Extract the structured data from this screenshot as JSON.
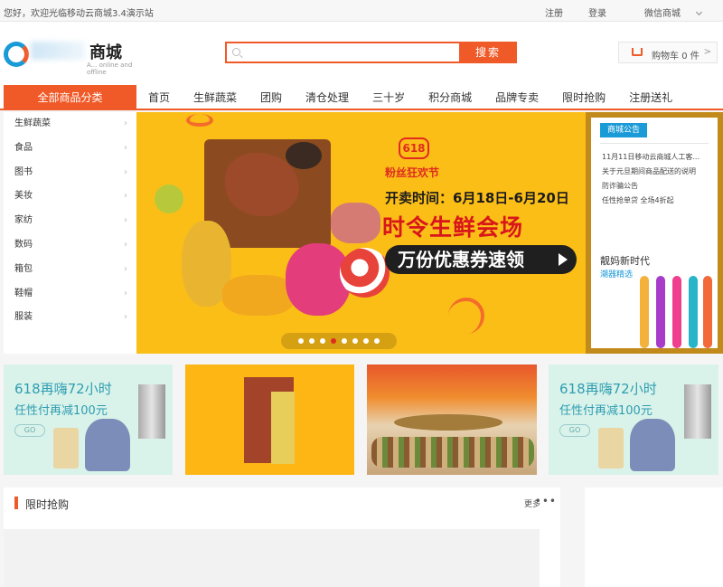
{
  "topbar": {
    "welcome": "您好，欢迎光临移动云商城3.4演示站",
    "register": "注册",
    "login": "登录",
    "wechat": "微信商城"
  },
  "header": {
    "logo_name": "商城",
    "logo_tagline": "A... online and offline",
    "search": {
      "value": "",
      "button": "搜索"
    },
    "cart": {
      "label": "购物车",
      "count": "0",
      "unit": "件",
      "arrow": ">"
    }
  },
  "nav": {
    "all_categories": "全部商品分类",
    "items": [
      "首页",
      "生鲜蔬菜",
      "团购",
      "清仓处理",
      "三十岁",
      "积分商城",
      "品牌专卖",
      "限时抢购",
      "注册送礼"
    ]
  },
  "categories": [
    "生鲜蔬菜",
    "食品",
    "图书",
    "美妆",
    "家纺",
    "数码",
    "箱包",
    "鞋帽",
    "服装"
  ],
  "banner": {
    "badge": "618",
    "fans": "粉丝狂欢节",
    "date": "开卖时间：6月18日-6月20日",
    "headline": "时令生鲜会场",
    "coupon": "万份优惠券速领",
    "dots": 8,
    "active_dot": 3
  },
  "notice": {
    "title": "商城公告",
    "items": [
      "11月11日移动云商城人工客...",
      "关于元旦期间商品配送的说明",
      "防诈骗公告",
      "任性抢单贷 全场4折起"
    ],
    "ad_title": "靓妈新时代",
    "ad_sub": "潮器精选",
    "wand_colors": [
      "#f4b13c",
      "#a63cc8",
      "#ef3f8e",
      "#27b5c8",
      "#f26a3a"
    ]
  },
  "promos": [
    {
      "title": "618再嗨72小时",
      "sub": "任性付再减100元",
      "go": "GO"
    },
    {
      "title": "618再嗨72小时",
      "sub": "任性付再减100元",
      "go": "GO"
    }
  ],
  "flash": {
    "title": "限时抢购",
    "more": "更多",
    "dots": "•••"
  }
}
